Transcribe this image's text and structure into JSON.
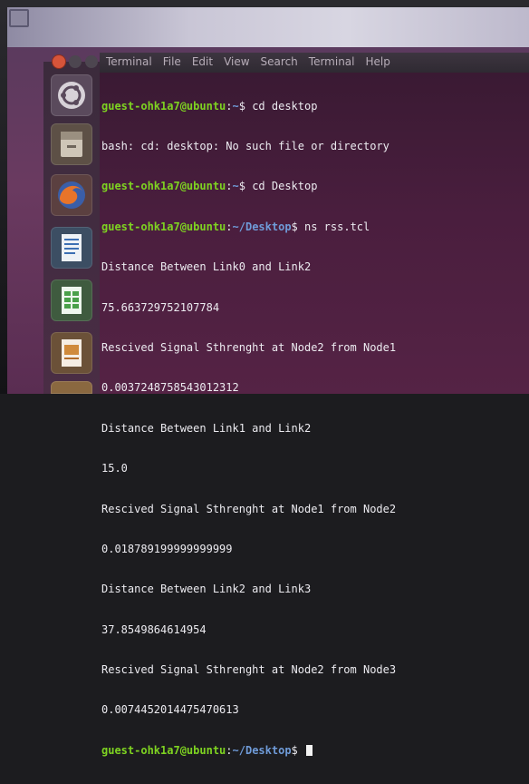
{
  "menubar": {
    "items": [
      "Terminal",
      "File",
      "Edit",
      "View",
      "Search",
      "Terminal",
      "Help"
    ]
  },
  "launcher": {
    "icons": [
      "ubuntu-logo-icon",
      "files-icon",
      "firefox-icon",
      "writer-icon",
      "calc-icon",
      "impress-icon",
      "software-center-icon"
    ]
  },
  "colors": {
    "prompt_user": "#7ed321",
    "prompt_path": "#6f9bd8",
    "terminal_bg": "#4a1e3e",
    "close_button": "#d6543a"
  },
  "terminal": {
    "lines": [
      {
        "user": "guest-ohk1a7@ubuntu",
        "sep": ":",
        "path": "~",
        "prompt": "$ ",
        "cmd": "cd desktop"
      },
      {
        "text": "bash: cd: desktop: No such file or directory"
      },
      {
        "user": "guest-ohk1a7@ubuntu",
        "sep": ":",
        "path": "~",
        "prompt": "$ ",
        "cmd": "cd Desktop"
      },
      {
        "user": "guest-ohk1a7@ubuntu",
        "sep": ":",
        "path": "~/Desktop",
        "prompt": "$ ",
        "cmd": "ns rss.tcl"
      },
      {
        "text": "Distance Between Link0 and Link2"
      },
      {
        "text": "75.663729752107784"
      },
      {
        "text": "Rescived Signal Sthrenght at Node2 from Node1"
      },
      {
        "text": "0.0037248758543012312"
      },
      {
        "text": "Distance Between Link1 and Link2"
      },
      {
        "text": "15.0"
      },
      {
        "text": "Rescived Signal Sthrenght at Node1 from Node2"
      },
      {
        "text": "0.018789199999999999"
      },
      {
        "text": "Distance Between Link2 and Link3"
      },
      {
        "text": "37.8549864614954"
      },
      {
        "text": "Rescived Signal Sthrenght at Node2 from Node3"
      },
      {
        "text": "0.0074452014475470613"
      },
      {
        "user": "guest-ohk1a7@ubuntu",
        "sep": ":",
        "path": "~/Desktop",
        "prompt": "$ ",
        "cmd": ""
      }
    ]
  }
}
